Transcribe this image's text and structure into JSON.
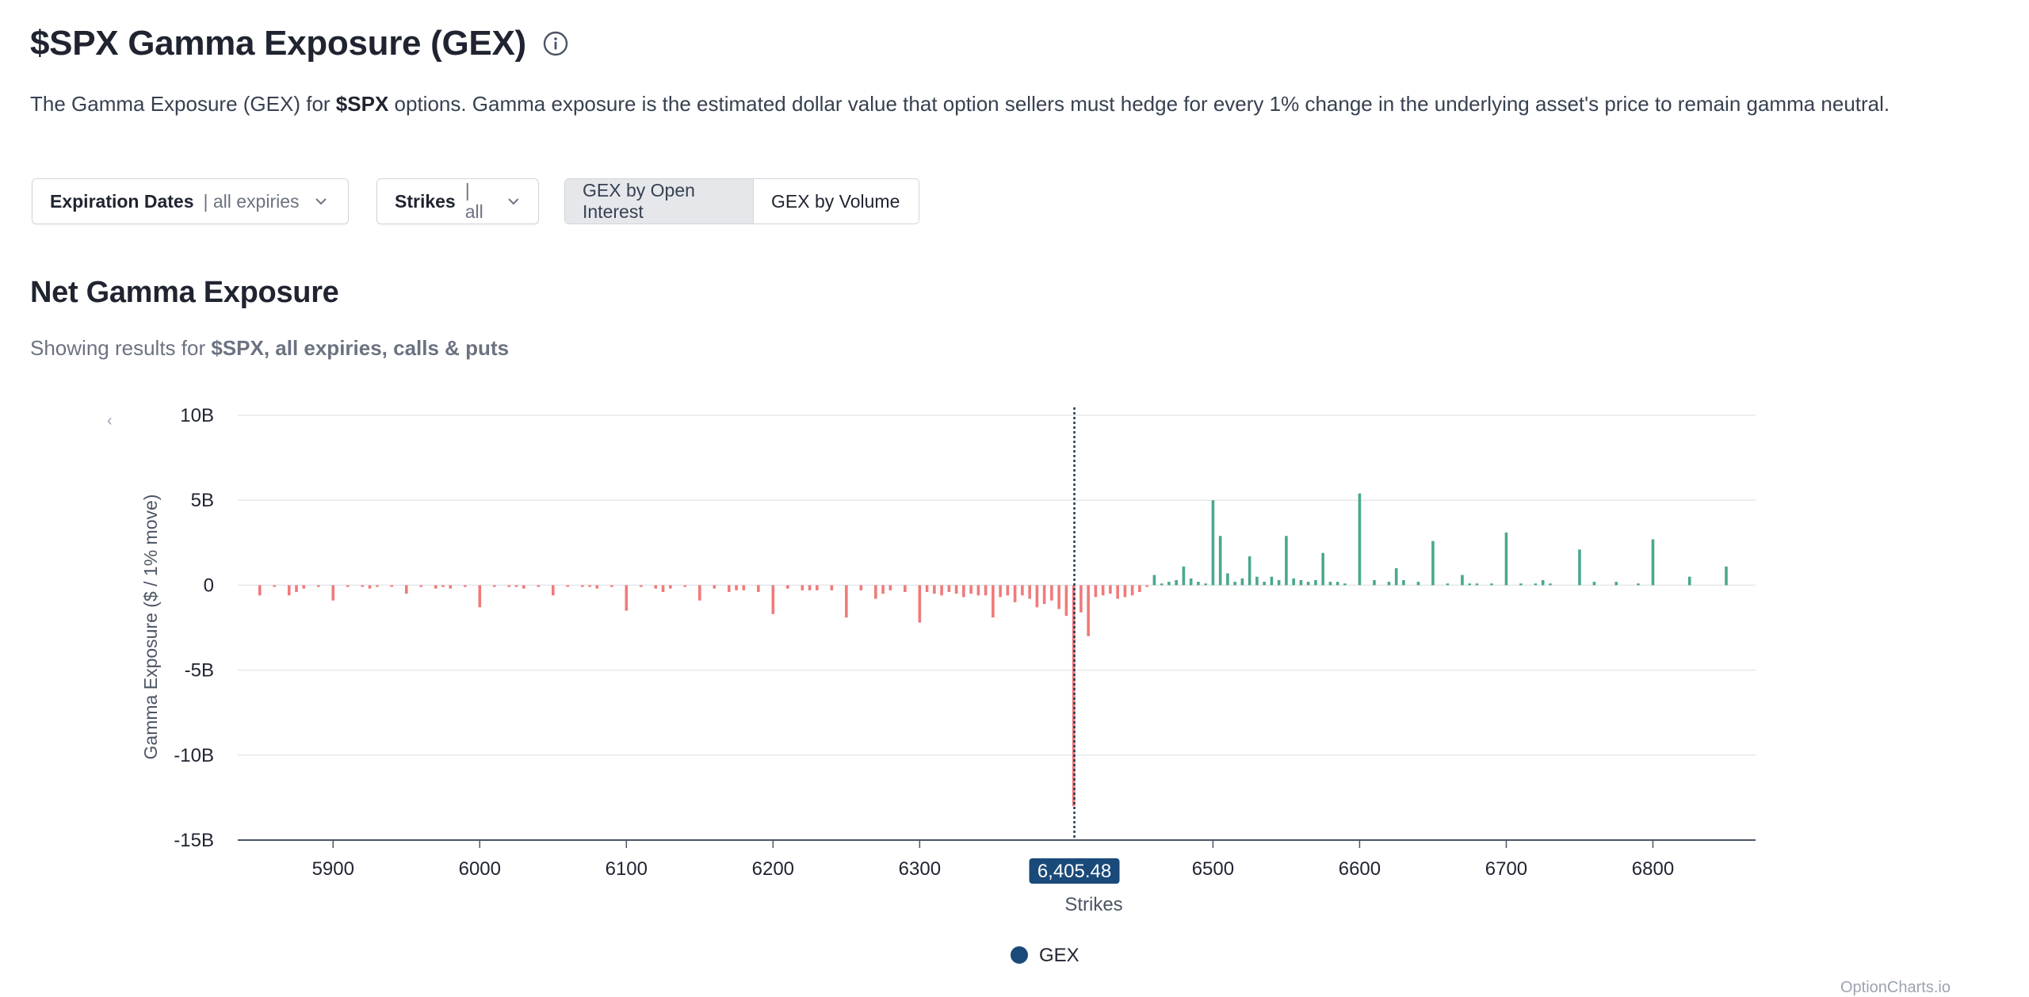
{
  "header": {
    "title": "$SPX Gamma Exposure (GEX)",
    "description_prefix": "The Gamma Exposure (GEX) for ",
    "description_symbol": "$SPX",
    "description_suffix": " options. Gamma exposure is the estimated dollar value that option sellers must hedge for every 1% change in the underlying asset's price to remain gamma neutral."
  },
  "controls": {
    "expiration_label": "Expiration Dates",
    "expiration_value": "| all expiries",
    "strikes_label": "Strikes",
    "strikes_value": "| all",
    "toggle_oi": "GEX by Open Interest",
    "toggle_volume": "GEX by Volume",
    "active_toggle": "oi"
  },
  "section": {
    "title": "Net Gamma Exposure",
    "subtitle_prefix": "Showing results for ",
    "subtitle_bold": "$SPX, all expiries, calls & puts"
  },
  "watermark": "OptionCharts.io",
  "colors": {
    "positive": "#4aa88f",
    "negative": "#f07a7a",
    "spot_line": "#1f3a5a",
    "spot_badge": "#1a4a7a",
    "legend_dot": "#1a4a7a"
  },
  "chart_data": {
    "type": "bar",
    "xlabel": "Strikes",
    "ylabel": "Gamma Exposure ($ / 1% move)",
    "xlim": [
      5835,
      6870
    ],
    "ylim": [
      -15,
      10
    ],
    "y_unit": "B",
    "yticks": [
      10,
      5,
      0,
      -5,
      -10,
      -15
    ],
    "ytick_labels": [
      "10B",
      "5B",
      "0",
      "-5B",
      "-10B",
      "-15B"
    ],
    "xticks": [
      5900,
      6000,
      6100,
      6200,
      6300,
      6500,
      6600,
      6700,
      6800
    ],
    "spot_price": 6405.48,
    "spot_label": "6,405.48",
    "grid": true,
    "legend": {
      "position": "bottom-center",
      "entries": [
        "GEX"
      ]
    },
    "series": [
      {
        "name": "GEX",
        "strikes": [
          5850,
          5860,
          5870,
          5875,
          5880,
          5890,
          5900,
          5910,
          5920,
          5925,
          5930,
          5940,
          5950,
          5960,
          5970,
          5975,
          5980,
          5990,
          6000,
          6010,
          6020,
          6025,
          6030,
          6040,
          6050,
          6060,
          6070,
          6075,
          6080,
          6090,
          6100,
          6110,
          6120,
          6125,
          6130,
          6140,
          6150,
          6160,
          6170,
          6175,
          6180,
          6190,
          6200,
          6210,
          6220,
          6225,
          6230,
          6240,
          6250,
          6260,
          6270,
          6275,
          6280,
          6290,
          6300,
          6305,
          6310,
          6315,
          6320,
          6325,
          6330,
          6335,
          6340,
          6345,
          6350,
          6355,
          6360,
          6365,
          6370,
          6375,
          6380,
          6385,
          6390,
          6395,
          6400,
          6405,
          6410,
          6415,
          6420,
          6425,
          6430,
          6435,
          6440,
          6445,
          6450,
          6455,
          6460,
          6465,
          6470,
          6475,
          6480,
          6485,
          6490,
          6495,
          6500,
          6505,
          6510,
          6515,
          6520,
          6525,
          6530,
          6535,
          6540,
          6545,
          6550,
          6555,
          6560,
          6565,
          6570,
          6575,
          6580,
          6585,
          6590,
          6600,
          6610,
          6620,
          6625,
          6630,
          6640,
          6650,
          6660,
          6670,
          6675,
          6680,
          6690,
          6700,
          6710,
          6720,
          6725,
          6730,
          6750,
          6760,
          6775,
          6790,
          6800,
          6825,
          6850
        ],
        "values": [
          -0.6,
          -0.1,
          -0.6,
          -0.4,
          -0.2,
          -0.1,
          -0.9,
          -0.1,
          -0.1,
          -0.2,
          -0.1,
          -0.1,
          -0.5,
          -0.1,
          -0.2,
          -0.1,
          -0.2,
          -0.1,
          -1.3,
          -0.1,
          -0.1,
          -0.1,
          -0.2,
          -0.1,
          -0.6,
          -0.1,
          -0.1,
          -0.1,
          -0.2,
          -0.1,
          -1.5,
          -0.1,
          -0.2,
          -0.4,
          -0.2,
          -0.1,
          -0.9,
          -0.2,
          -0.4,
          -0.3,
          -0.3,
          -0.4,
          -1.7,
          -0.2,
          -0.3,
          -0.3,
          -0.3,
          -0.3,
          -1.9,
          -0.3,
          -0.8,
          -0.5,
          -0.3,
          -0.4,
          -2.2,
          -0.4,
          -0.5,
          -0.6,
          -0.4,
          -0.5,
          -0.7,
          -0.5,
          -0.6,
          -0.6,
          -1.9,
          -0.7,
          -0.6,
          -1.0,
          -0.6,
          -0.8,
          -1.3,
          -1.1,
          -0.9,
          -1.4,
          -1.8,
          -13.0,
          -1.6,
          -3.0,
          -0.7,
          -0.6,
          -0.5,
          -0.8,
          -0.7,
          -0.6,
          -0.4,
          -0.1,
          0.6,
          0.1,
          0.2,
          0.3,
          1.1,
          0.4,
          0.2,
          0.1,
          5.0,
          2.9,
          0.7,
          0.2,
          0.4,
          1.7,
          0.5,
          0.2,
          0.5,
          0.3,
          2.9,
          0.4,
          0.3,
          0.2,
          0.3,
          1.9,
          0.2,
          0.2,
          0.1,
          5.4,
          0.3,
          0.2,
          1.0,
          0.3,
          0.2,
          2.6,
          0.1,
          0.6,
          0.1,
          0.1,
          0.1,
          3.1,
          0.1,
          0.1,
          0.3,
          0.1,
          2.1,
          0.2,
          0.2,
          0.1,
          2.7,
          0.5,
          1.1
        ]
      }
    ]
  }
}
